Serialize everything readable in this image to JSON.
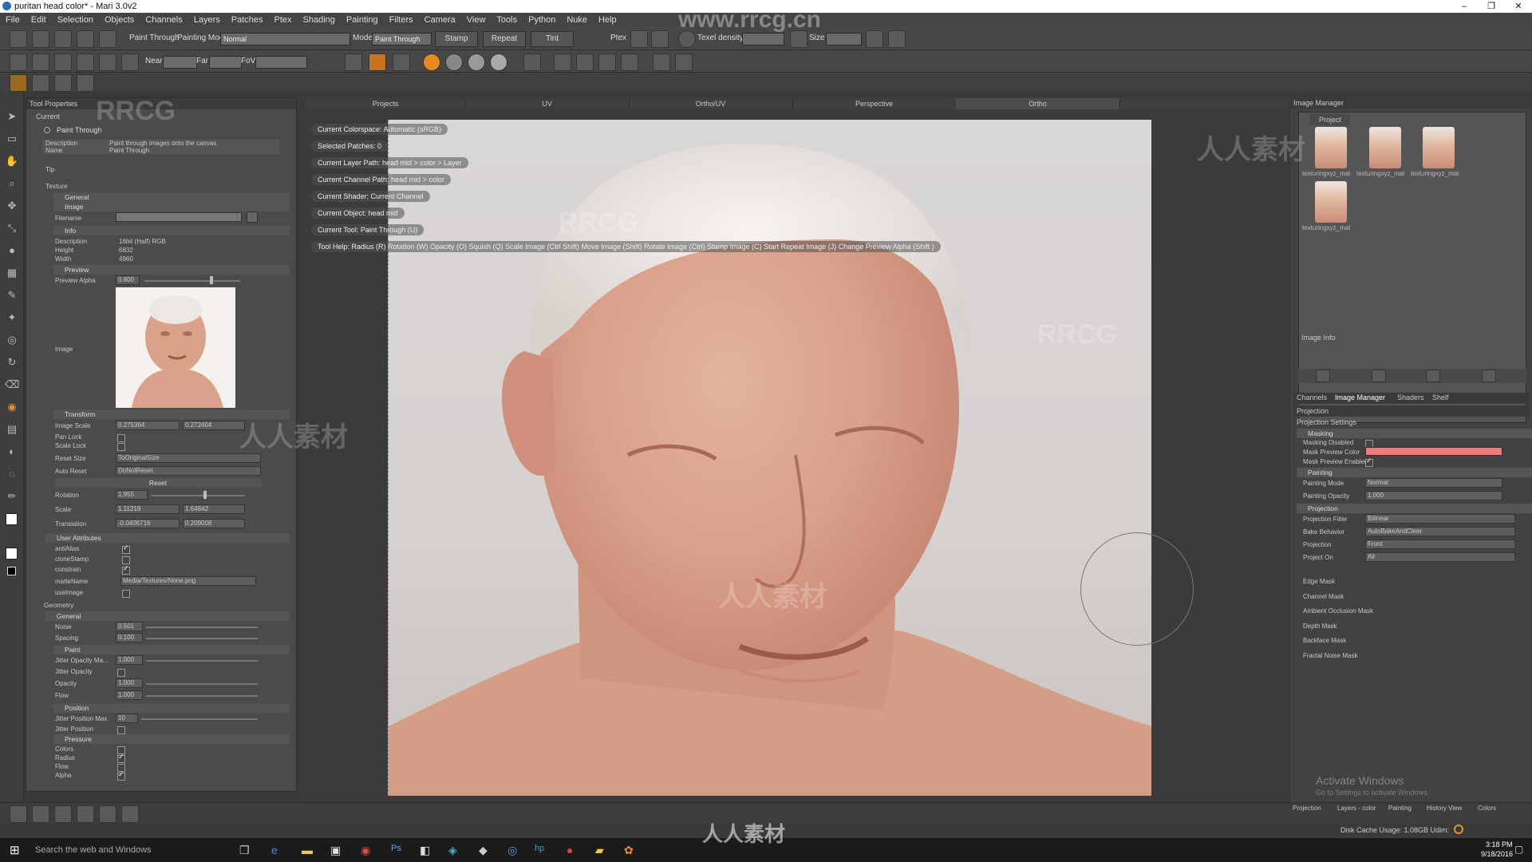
{
  "window": {
    "title": "puritan head color* - Mari 3.0v2",
    "minimize": "–",
    "maximize": "❐",
    "close": "✕"
  },
  "menu": [
    "File",
    "Edit",
    "Selection",
    "Objects",
    "Channels",
    "Layers",
    "Patches",
    "Ptex",
    "Shading",
    "Painting",
    "Filters",
    "Camera",
    "View",
    "Tools",
    "Python",
    "Nuke",
    "Help"
  ],
  "watermark_site": "www.rrcg.cn",
  "toolbar1": {
    "paint_through": "Paint Through",
    "painting_mode_label": "Painting Mode",
    "painting_mode_value": "Normal",
    "mode_label": "Mode",
    "mode_value": "Paint Through",
    "stamp": "Stamp",
    "repeat": "Repeat",
    "tint": "Tint",
    "ptex_label": "Ptex",
    "texel_density_label": "Texel density",
    "size_label": "Size"
  },
  "toolbar2": {
    "near": "Near",
    "far": "Far",
    "fov": "FoV"
  },
  "tool_properties": {
    "header": "Tool Properties",
    "current": "Current",
    "tool_name": "Paint Through",
    "description_label": "Description",
    "description_value": "Paint through images onto the canvas",
    "name_label": "Name",
    "name_value": "Paint Through",
    "tip": "Tip",
    "texture": "Texture",
    "general": "General",
    "image": "Image",
    "filename_label": "Filename",
    "info": "Info",
    "info_description_label": "Description",
    "info_description_value": "16bit (Half) RGB",
    "height_label": "Height",
    "height_value": "6832",
    "width_label": "Width",
    "width_value": "4960",
    "preview": "Preview",
    "preview_alpha_label": "Preview Alpha",
    "preview_alpha_value": "0.800",
    "image_label": "Image",
    "transform": "Transform",
    "image_scale_label": "Image Scale",
    "image_scale_x": "0.275364",
    "image_scale_y": "0.272404",
    "pan_lock": "Pan Lock",
    "scale_lock": "Scale Lock",
    "reset_size_label": "Reset Size",
    "reset_size_value": "ToOriginalSize",
    "auto_reset_label": "Auto Reset",
    "auto_reset_value": "DoNotReset",
    "reset_button": "Reset",
    "rotation_label": "Rotation",
    "rotation_value": "1.955",
    "scale_label": "Scale",
    "scale_x": "1.11219",
    "scale_y": "1.64842",
    "translation_label": "Translation",
    "translation_x": "-0.0406716",
    "translation_y": "0.209008",
    "user_attributes": "User Attributes",
    "antialias": "antiAlias",
    "clonestamp": "cloneStamp",
    "constrain": "constrain",
    "mattename_label": "matteName",
    "mattename_value": "Media/Textures/None.png",
    "useimage": "useImage",
    "geometry": "Geometry",
    "geo_general": "General",
    "noise_label": "Noise",
    "noise_value": "0.501",
    "spacing_label": "Spacing",
    "spacing_value": "0.100",
    "paint": "Paint",
    "jitter_opacity_max_label": "Jitter Opacity Ma...",
    "jitter_opacity_max_value": "1.000",
    "jitter_opacity_label": "Jitter Opacity",
    "opacity_label": "Opacity",
    "opacity_value": "1.000",
    "flow_label": "Flow",
    "flow_value": "1.000",
    "position": "Position",
    "jitter_position_max_label": "Jitter Position Max",
    "jitter_position_max_value": "10",
    "jitter_position_label": "Jitter Position",
    "pressure": "Pressure",
    "colors": "Colors",
    "radius": "Radius",
    "flow": "Flow",
    "alpha": "Alpha"
  },
  "viewport_tabs": [
    "Projects",
    "UV",
    "Ortho/UV",
    "Perspective",
    "Ortho"
  ],
  "hud": [
    "Current Colorspace: Automatic (sRGB)",
    "Selected Patches: 0",
    "Current Layer Path: head mid > color > Layer",
    "Current Channel Path: head mid > color",
    "Current Shader: Current Channel",
    "Current Object: head mid",
    "Current Tool: Paint Through (U)",
    "Tool Help:  Radius (R)  Rotation (W)  Opacity (O)  Squish (Q)  Scale Image (Ctrl Shift) Move Image (Shift) Rotate Image (Ctrl) Stamp Image (C) Start Repeat Image (J) Change Preview Alpha (Shift )"
  ],
  "image_manager": {
    "header": "Image Manager",
    "project_tab": "Project",
    "thumb_names": [
      "texturingxyz_mal",
      "texturingxyz_mal",
      "texturingxyz_mal",
      "texturingxyz_mal"
    ],
    "image_info": "Image Info",
    "tabs": [
      "Channels",
      "Image Manager",
      "Shaders",
      "Shelf"
    ]
  },
  "projection": {
    "header": "Projection",
    "settings": "Projection Settings",
    "masking": "Masking",
    "masking_disabled": "Masking Disabled",
    "mask_preview_color": "Mask Preview Color",
    "mask_preview_color_value": "#f07a7a",
    "mask_preview_enabled": "Mask Preview Enabled",
    "painting": "Painting",
    "painting_mode_label": "Painting Mode",
    "painting_mode_value": "Normal",
    "painting_opacity_label": "Painting Opacity",
    "painting_opacity_value": "1.000",
    "projection": "Projection",
    "projection_filter_label": "Projection Filter",
    "projection_filter_value": "Bilinear",
    "bake_behavior_label": "Bake Behavior",
    "bake_behavior_value": "AutoBakeAndClear",
    "projection_label": "Projection",
    "projection_value": "Front",
    "project_on_label": "Project On",
    "project_on_value": "All",
    "masks": [
      "Edge Mask",
      "Channel Mask",
      "Ambient Occlusion Mask",
      "Depth Mask",
      "Backface Mask",
      "Fractal Noise Mask"
    ]
  },
  "activate_windows": "Activate Windows",
  "activate_windows_sub": "Go to Settings to activate Windows.",
  "bottom_tabs": [
    "Projection",
    "Layers - color",
    "Painting",
    "History View",
    "Colors"
  ],
  "status": {
    "disk_cache": "Disk Cache Usage: 1.08GB  Udim:"
  },
  "taskbar": {
    "search": "Search the web and Windows",
    "time": "3:18 PM",
    "date": "9/18/2016"
  },
  "watermarks": [
    "RRCG",
    "人人素材"
  ]
}
